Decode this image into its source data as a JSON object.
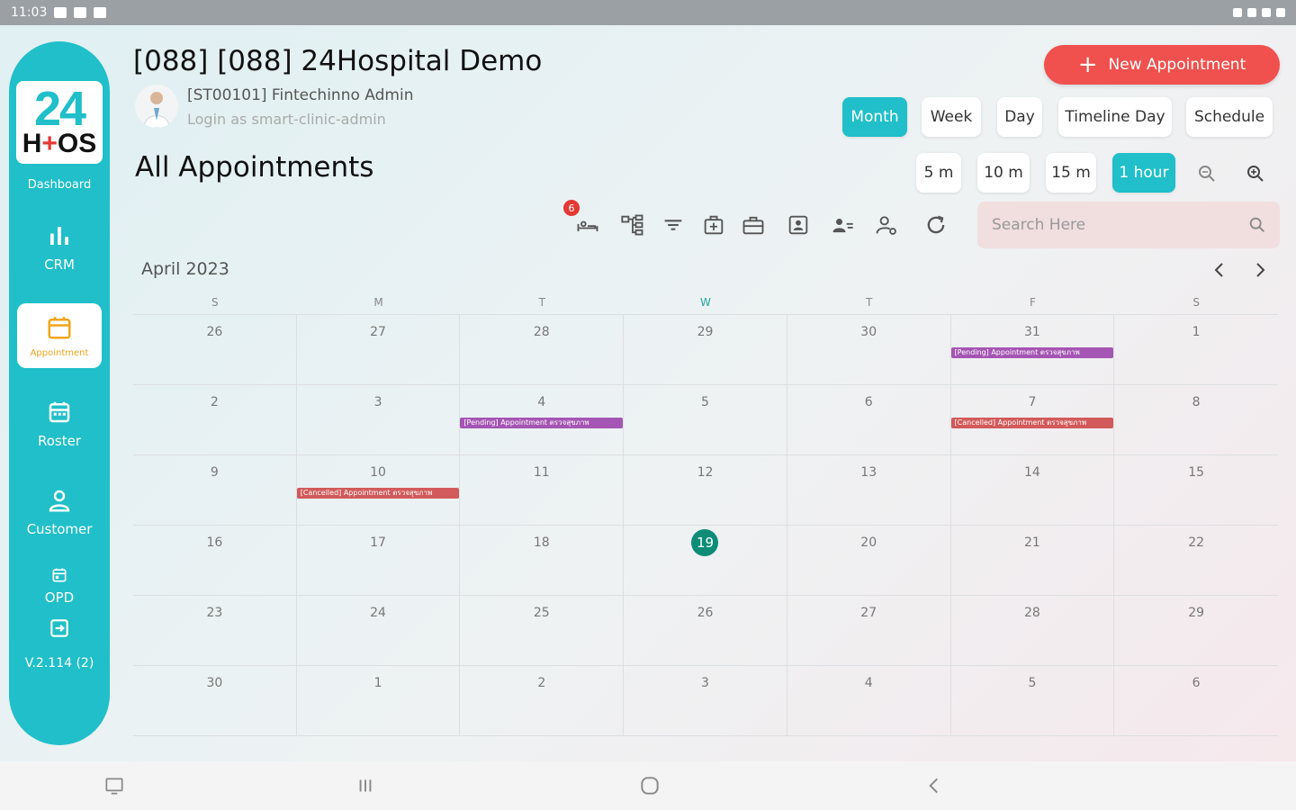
{
  "status_bar": {
    "time": "11:03"
  },
  "sidebar": {
    "logo_top": "24",
    "logo_bottom_left": "H",
    "logo_bottom_plus": "+",
    "logo_bottom_right": "OS",
    "dashboard_label": "Dashboard",
    "items": [
      {
        "label": "CRM",
        "icon": "bar-chart-icon"
      },
      {
        "label": "Appointment",
        "icon": "calendar-icon",
        "active": true
      },
      {
        "label": "Roster",
        "icon": "roster-calendar-icon"
      },
      {
        "label": "Customer",
        "icon": "person-icon"
      },
      {
        "label": "OPD",
        "icon": "opd-calendar-icon"
      }
    ],
    "version": "V.2.114 (2)"
  },
  "header": {
    "hospital_title": "[088] [088] 24Hospital Demo",
    "user_name": "[ST00101] Fintechinno Admin",
    "login_as": "Login as smart-clinic-admin",
    "page_title": "All Appointments",
    "new_appointment_label": "New Appointment"
  },
  "view_modes": [
    "Month",
    "Week",
    "Day",
    "Timeline Day",
    "Schedule"
  ],
  "active_view": "Month",
  "intervals": [
    "5 m",
    "10 m",
    "15 m",
    "1 hour"
  ],
  "active_interval": "1 hour",
  "toolbar": {
    "notification_count": "6"
  },
  "search": {
    "placeholder": "Search Here",
    "value": ""
  },
  "calendar": {
    "month_label": "April 2023",
    "day_headers": [
      "S",
      "M",
      "T",
      "W",
      "T",
      "F",
      "S"
    ],
    "today_column": 3,
    "weeks": [
      [
        "26",
        "27",
        "28",
        "29",
        "30",
        "31",
        "1"
      ],
      [
        "2",
        "3",
        "4",
        "5",
        "6",
        "7",
        "8"
      ],
      [
        "9",
        "10",
        "11",
        "12",
        "13",
        "14",
        "15"
      ],
      [
        "16",
        "17",
        "18",
        "19",
        "20",
        "21",
        "22"
      ],
      [
        "23",
        "24",
        "25",
        "26",
        "27",
        "28",
        "29"
      ],
      [
        "30",
        "1",
        "2",
        "3",
        "4",
        "5",
        "6"
      ]
    ],
    "today_date": "19",
    "events": [
      {
        "week": 0,
        "day": 5,
        "label": "[Pending] Appointment ตรวจสุขภาพ",
        "color": "#a555b3"
      },
      {
        "week": 1,
        "day": 2,
        "label": "[Pending] Appointment ตรวจสุขภาพ",
        "color": "#a555b3"
      },
      {
        "week": 1,
        "day": 5,
        "label": "[Cancelled] Appointment ตรวจสุขภาพ",
        "color": "#d35a5a"
      },
      {
        "week": 2,
        "day": 1,
        "label": "[Cancelled] Appointment ตรวจสุขภาพ",
        "color": "#d35a5a"
      }
    ]
  },
  "colors": {
    "brand_teal": "#20bfc9",
    "new_appointment_red": "#f0514f",
    "today_green": "#0e8c78",
    "active_nav_text": "#f2a51a"
  }
}
